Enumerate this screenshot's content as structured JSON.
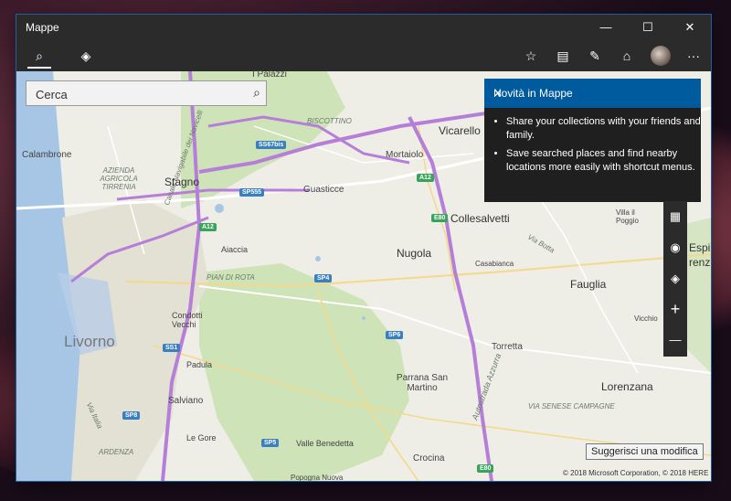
{
  "window": {
    "title": "Mappe"
  },
  "titlebar": {
    "minimize": "—",
    "maximize": "☐",
    "close": "✕"
  },
  "toolbar": {
    "search_icon": "⌕",
    "directions_icon": "◈",
    "favorites_icon": "☆",
    "collections_icon": "▤",
    "ink_icon": "✎",
    "landmarks_icon": "⌂",
    "more_icon": "···"
  },
  "search": {
    "placeholder": "Cerca",
    "value": ""
  },
  "panel": {
    "title": "Novità in Mappe",
    "close": "✕",
    "items": [
      "Share your collections with your friends and family.",
      "Save searched places and find nearby locations more easily with shortcut menus."
    ]
  },
  "controls": {
    "view_icon": "▦",
    "location_icon": "◉",
    "layers_icon": "◈",
    "zoom_in": "+",
    "zoom_out": "—"
  },
  "map_labels": {
    "calambrone": "Calambrone",
    "azienda": "AZIENDA AGRICOLA TIRRENIA",
    "canale": "Canale Navigabile dei Navicelli",
    "ipalazzi": "I Palazzi",
    "biscottino": "BISCOTTINO",
    "stagno": "Stagno",
    "guasticce": "Guasticce",
    "mortaiolo": "Mortaiolo",
    "vicarello": "Vicarello",
    "collesalvetti": "Collesalvetti",
    "villail": "Villa il Poggio",
    "viabotta": "Via Botta",
    "casabianca": "Casabianca",
    "aiaccia": "Aiaccia",
    "nugola": "Nugola",
    "piandirota": "PIAN DI ROTA",
    "fauglia": "Fauglia",
    "condotti": "Condotti Vecchi",
    "livorno": "Livorno",
    "vicchio": "Vicchio",
    "torretta": "Torretta",
    "padula": "Padula",
    "parrana": "Parrana San Martino",
    "autostrada": "Autostrada Azzurra",
    "lorenzana": "Lorenzana",
    "salviano": "Salviano",
    "viaitalia": "Via Italia",
    "legore": "Le Gore",
    "valle": "Valle Benedetta",
    "crocina": "Crocina",
    "ardenza": "ARDENZA",
    "popogna": "Popogna Nuova",
    "espin": "Espin",
    "renza": "renza",
    "viasen": "VIA SENESE CAMPAGNE"
  },
  "shields": {
    "sss67bis": "SS67bis",
    "a12a": "A12",
    "a12b": "A12",
    "sp555": "SP555",
    "e80a": "E80",
    "e80b": "E80",
    "sp4": "SP4",
    "sp6": "SP6",
    "ss1": "SS1",
    "sp8": "SP8",
    "sp5": "SP5"
  },
  "suggest_button": "Suggerisci una modifica",
  "copyright": "© 2018 Microsoft Corporation, © 2018 HERE",
  "colors": {
    "accent": "#005a9e",
    "chrome": "#2b2b2b",
    "highway": "#b57fd8",
    "park": "#cfe3b8",
    "sea": "#a7c6e6"
  }
}
